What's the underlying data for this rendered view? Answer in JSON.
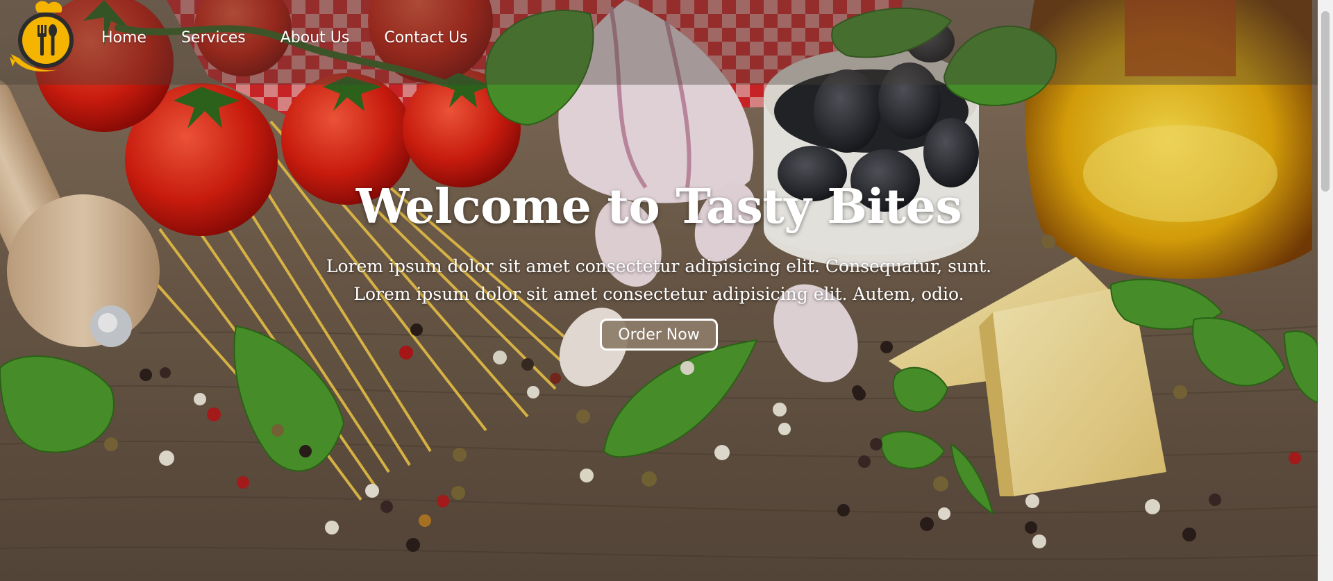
{
  "header": {
    "logo_icon": "chef-hat-fork-spoon-icon",
    "brand_color": "#f4b400",
    "nav": [
      {
        "label": "Home"
      },
      {
        "label": "Services"
      },
      {
        "label": "About Us"
      },
      {
        "label": "Contact Us"
      }
    ]
  },
  "hero": {
    "title": "Welcome to Tasty Bites",
    "lines": [
      "Lorem ipsum dolor sit amet consectetur adipisicing elit. Consequatur, sunt.",
      "Lorem ipsum dolor sit amet consectetur adipisicing elit. Autem, odio."
    ],
    "button_label": "Order Now",
    "button_color": "#8c7c68"
  },
  "background": {
    "subject": "ingredients on wooden table: tomatoes, spaghetti, garlic, olives, cheese, basil, olive oil, peppercorns"
  }
}
